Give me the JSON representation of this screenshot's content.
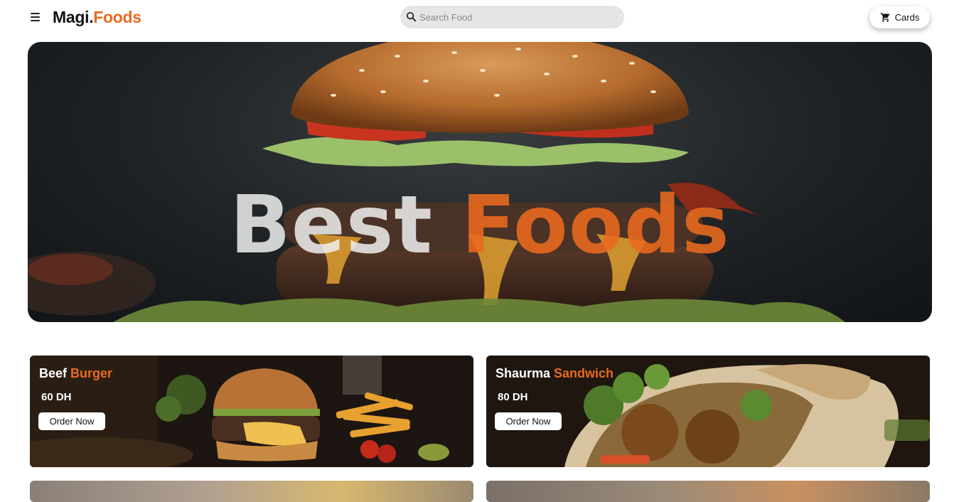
{
  "navbar": {
    "menu_icon": "hamburger-menu-icon",
    "logo": {
      "prefix": "Magi.",
      "accent": "Foods"
    },
    "search": {
      "placeholder": "Search Food",
      "value": "",
      "icon": "search-icon"
    },
    "cart": {
      "label": "Cards",
      "icon": "cart-icon"
    }
  },
  "hero": {
    "title_plain": "Best ",
    "title_accent": "Foods"
  },
  "cards": [
    {
      "name_plain": "Beef ",
      "name_accent": "Burger",
      "price": "60 DH",
      "button": "Order Now"
    },
    {
      "name_plain": "Shaurma ",
      "name_accent": "Sandwich",
      "price": "80 DH",
      "button": "Order Now"
    }
  ],
  "colors": {
    "accent": "#ea6a1f",
    "text_dark": "#111111",
    "search_bg": "#e6e6e6"
  }
}
